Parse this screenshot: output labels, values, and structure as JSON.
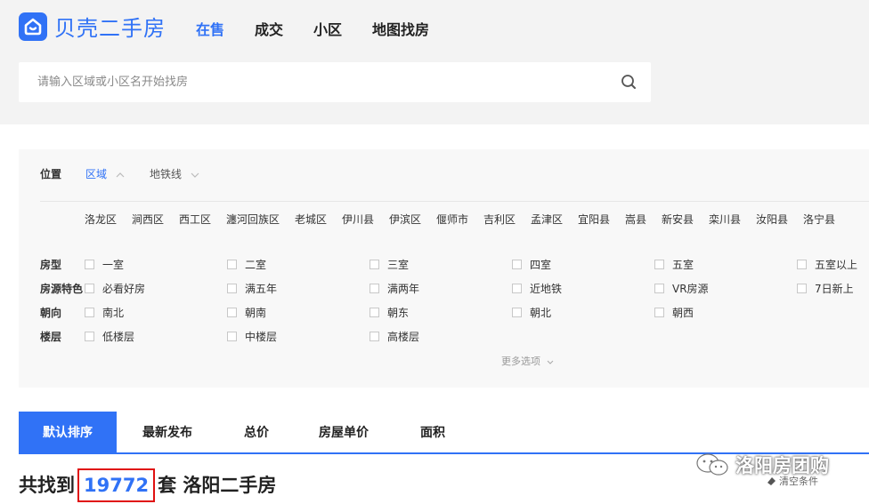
{
  "brand": {
    "name": "贝壳二手房",
    "color": "#3072f6"
  },
  "nav": {
    "items": [
      "在售",
      "成交",
      "小区",
      "地图找房"
    ],
    "active": "在售"
  },
  "search": {
    "placeholder": "请输入区域或小区名开始找房",
    "value": "",
    "icon": "search-icon"
  },
  "filters": {
    "location": {
      "label": "位置",
      "tabs": [
        "区域",
        "地铁线"
      ],
      "active_tab": "区域",
      "districts": [
        "洛龙区",
        "涧西区",
        "西工区",
        "瀍河回族区",
        "老城区",
        "伊川县",
        "伊滨区",
        "偃师市",
        "吉利区",
        "孟津区",
        "宜阳县",
        "嵩县",
        "新安县",
        "栾川县",
        "汝阳县",
        "洛宁县"
      ]
    },
    "rows": [
      {
        "label": "房型",
        "options": [
          "一室",
          "二室",
          "三室",
          "四室",
          "五室",
          "五室以上"
        ]
      },
      {
        "label": "房源特色",
        "options": [
          "必看好房",
          "满五年",
          "满两年",
          "近地铁",
          "VR房源",
          "7日新上"
        ]
      },
      {
        "label": "朝向",
        "options": [
          "南北",
          "朝南",
          "朝东",
          "朝北",
          "朝西"
        ]
      },
      {
        "label": "楼层",
        "options": [
          "低楼层",
          "中楼层",
          "高楼层"
        ]
      }
    ],
    "more": "更多选项"
  },
  "sort": {
    "items": [
      "默认排序",
      "最新发布",
      "总价",
      "房屋单价",
      "面积"
    ],
    "active": "默认排序"
  },
  "result": {
    "prefix": "共找到",
    "count": "19772",
    "suffix": "套 洛阳二手房"
  },
  "clear": "清空条件",
  "watermark": "洛阳房团购"
}
